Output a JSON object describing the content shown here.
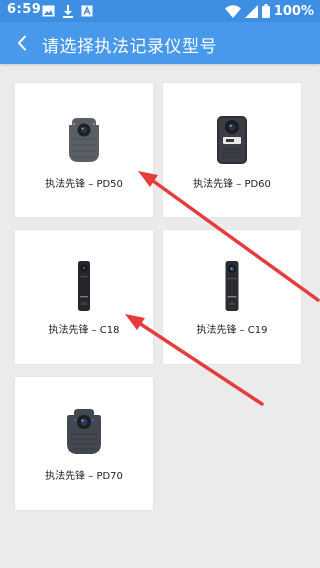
{
  "status_bar": {
    "time": "6:59",
    "battery": "100%",
    "icons": [
      "gallery-icon",
      "download-icon",
      "letter-a-icon",
      "wifi-icon",
      "signal-icon",
      "battery-icon"
    ]
  },
  "header": {
    "title": "请选择执法记录仪型号",
    "back_icon": "chevron-left-icon"
  },
  "devices": [
    {
      "label": "执法先锋 – PD50",
      "icon": "pd50-camera"
    },
    {
      "label": "执法先锋 – PD60",
      "icon": "pd60-camera"
    },
    {
      "label": "执法先锋 – C18",
      "icon": "c18-camera"
    },
    {
      "label": "执法先锋 – C19",
      "icon": "c19-camera"
    },
    {
      "label": "执法先锋 – PD70",
      "icon": "pd70-camera"
    }
  ],
  "colors": {
    "status_bar": "#3e8ee4",
    "app_bar": "#4899ec",
    "background": "#ebebeb",
    "card": "#ffffff",
    "annotation_arrow": "#e53c3c"
  }
}
